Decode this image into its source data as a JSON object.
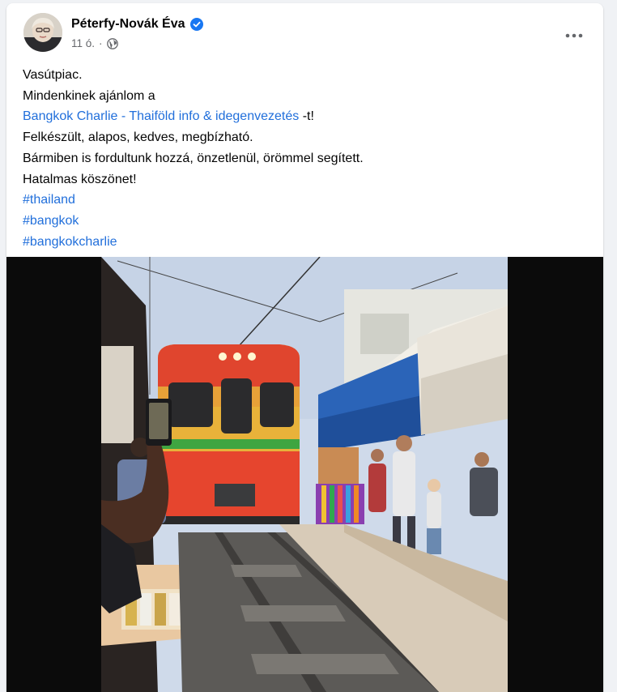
{
  "post": {
    "author": "Péterfy-Novák Éva",
    "time": "11 ó.",
    "separator": "·",
    "more_label": "•••",
    "lines": {
      "l1": "Vasútpiac.",
      "l2": "Mindenkinek ajánlom a",
      "l3_link": "Bangkok Charlie - Thaiföld info & idegenvezetés",
      "l3_suffix": " -t!",
      "l4": "Felkészült, alapos, kedves, megbízható.",
      "l5": "Bármiben is fordultunk hozzá, önzetlenül, örömmel segített.",
      "l6": "Hatalmas köszönet!",
      "tag1": "#thailand",
      "tag2": "#bangkok",
      "tag3": "#bangkokcharlie"
    }
  },
  "icons": {
    "verified": "verified-badge-icon",
    "audience": "globe-icon",
    "more": "more-options-icon"
  },
  "colors": {
    "link": "#216fdb",
    "verified": "#1877f2",
    "meta_text": "#65676b",
    "page_bg": "#f0f2f5"
  }
}
